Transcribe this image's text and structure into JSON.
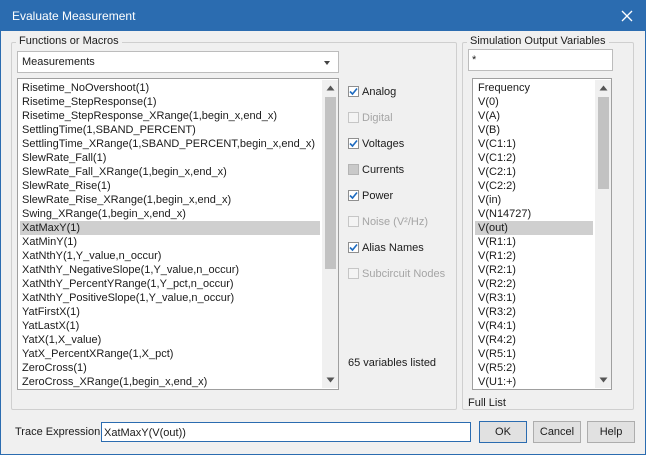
{
  "window": {
    "title": "Evaluate Measurement"
  },
  "functions": {
    "group_label": "Functions or Macros",
    "combo_value": "Measurements",
    "items": [
      "Risetime_NoOvershoot(1)",
      "Risetime_StepResponse(1)",
      "Risetime_StepResponse_XRange(1,begin_x,end_x)",
      "SettlingTime(1,SBAND_PERCENT)",
      "SettlingTime_XRange(1,SBAND_PERCENT,begin_x,end_x)",
      "SlewRate_Fall(1)",
      "SlewRate_Fall_XRange(1,begin_x,end_x)",
      "SlewRate_Rise(1)",
      "SlewRate_Rise_XRange(1,begin_x,end_x)",
      "Swing_XRange(1,begin_x,end_x)",
      "XatMaxY(1)",
      "XatMinY(1)",
      "XatNthY(1,Y_value,n_occur)",
      "XatNthY_NegativeSlope(1,Y_value,n_occur)",
      "XatNthY_PercentYRange(1,Y_pct,n_occur)",
      "XatNthY_PositiveSlope(1,Y_value,n_occur)",
      "YatFirstX(1)",
      "YatLastX(1)",
      "YatX(1,X_value)",
      "YatX_PercentXRange(1,X_pct)",
      "ZeroCross(1)",
      "ZeroCross_XRange(1,begin_x,end_x)"
    ],
    "selected_index": 10
  },
  "filters": [
    {
      "label": "Analog",
      "checked": true,
      "enabled": true
    },
    {
      "label": "Digital",
      "checked": false,
      "enabled": false
    },
    {
      "label": "Voltages",
      "checked": true,
      "enabled": true
    },
    {
      "label": "Currents",
      "checked": false,
      "enabled": true
    },
    {
      "label": "Power",
      "checked": true,
      "enabled": true
    },
    {
      "label": "Noise (V²/Hz)",
      "checked": false,
      "enabled": false
    },
    {
      "label": "Alias Names",
      "checked": true,
      "enabled": true
    },
    {
      "label": "Subcircuit Nodes",
      "checked": false,
      "enabled": false
    }
  ],
  "status_text": "65 variables listed",
  "variables": {
    "group_label": "Simulation Output Variables",
    "filter_value": "*",
    "items": [
      "Frequency",
      "V(0)",
      "V(A)",
      "V(B)",
      "V(C1:1)",
      "V(C1:2)",
      "V(C2:1)",
      "V(C2:2)",
      "V(in)",
      "V(N14727)",
      "V(out)",
      "V(R1:1)",
      "V(R1:2)",
      "V(R2:1)",
      "V(R2:2)",
      "V(R3:1)",
      "V(R3:2)",
      "V(R4:1)",
      "V(R4:2)",
      "V(R5:1)",
      "V(R5:2)",
      "V(U1:+)"
    ],
    "selected_index": 10,
    "full_list_label": "Full List"
  },
  "trace": {
    "label": "Trace Expression:",
    "value": "XatMaxY(V(out))"
  },
  "buttons": {
    "ok": "OK",
    "cancel": "Cancel",
    "help": "Help"
  },
  "colors": {
    "titlebar": "#2b6cb0",
    "selection": "#cfcfcf",
    "checkbox_check": "#1e6bc0"
  }
}
